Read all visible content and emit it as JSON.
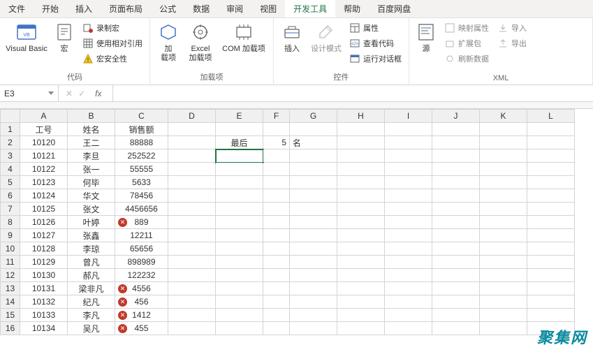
{
  "tabs": [
    "文件",
    "开始",
    "插入",
    "页面布局",
    "公式",
    "数据",
    "审阅",
    "视图",
    "开发工具",
    "帮助",
    "百度网盘"
  ],
  "activeTab": 8,
  "ribbon": {
    "group1": {
      "label": "代码",
      "visualBasic": "Visual Basic",
      "macros": "宏",
      "recordMacro": "录制宏",
      "useRelative": "使用相对引用",
      "macroSecurity": "宏安全性"
    },
    "group2": {
      "label": "加载项",
      "addins": "加\n载项",
      "excelAddins": "Excel\n加载项",
      "comAddins": "COM 加载项"
    },
    "group3": {
      "label": "控件",
      "insert": "插入",
      "designMode": "设计模式",
      "properties": "属性",
      "viewCode": "查看代码",
      "runDialog": "运行对话框"
    },
    "group4": {
      "label": "XML",
      "source": "源",
      "mapProps": "映射属性",
      "expandPack": "扩展包",
      "refreshData": "刷新数据",
      "import": "导入",
      "export": "导出"
    }
  },
  "nameBox": "E3",
  "formula": "",
  "columns": [
    "A",
    "B",
    "C",
    "D",
    "E",
    "F",
    "G",
    "H",
    "I",
    "J",
    "K",
    "L"
  ],
  "rows": [
    1,
    2,
    3,
    4,
    5,
    6,
    7,
    8,
    9,
    10,
    11,
    12,
    13,
    14,
    15,
    16
  ],
  "headerRow": {
    "A": "工号",
    "B": "姓名",
    "C": "销售额"
  },
  "filterRow": {
    "E": "最后",
    "F": "5",
    "G": "名"
  },
  "data": [
    {
      "A": "10120",
      "B": "王二",
      "C": "88888",
      "mark": false
    },
    {
      "A": "10121",
      "B": "李旦",
      "C": "252522",
      "mark": false
    },
    {
      "A": "10122",
      "B": "张一",
      "C": "55555",
      "mark": false
    },
    {
      "A": "10123",
      "B": "何毕",
      "C": "5633",
      "mark": false
    },
    {
      "A": "10124",
      "B": "华文",
      "C": "78456",
      "mark": false
    },
    {
      "A": "10125",
      "B": "张文",
      "C": "4456656",
      "mark": false
    },
    {
      "A": "10126",
      "B": "叶婷",
      "C": "889",
      "mark": true
    },
    {
      "A": "10127",
      "B": "张鑫",
      "C": "12211",
      "mark": false
    },
    {
      "A": "10128",
      "B": "李琼",
      "C": "65656",
      "mark": false
    },
    {
      "A": "10129",
      "B": "曾凡",
      "C": "898989",
      "mark": false
    },
    {
      "A": "10130",
      "B": "郝凡",
      "C": "122232",
      "mark": false
    },
    {
      "A": "10131",
      "B": "梁非凡",
      "C": "4556",
      "mark": true
    },
    {
      "A": "10132",
      "B": "纪凡",
      "C": "456",
      "mark": true
    },
    {
      "A": "10133",
      "B": "李凡",
      "C": "1412",
      "mark": true
    },
    {
      "A": "10134",
      "B": "吴凡",
      "C": "455",
      "mark": true
    }
  ],
  "selectedCell": "E3",
  "colWidths": {
    "A": 68,
    "B": 68,
    "C": 76,
    "D": 68,
    "E": 68,
    "F": 38,
    "G": 68,
    "H": 68,
    "I": 68,
    "J": 68,
    "K": 68,
    "L": 68
  },
  "watermark": "聚集网"
}
